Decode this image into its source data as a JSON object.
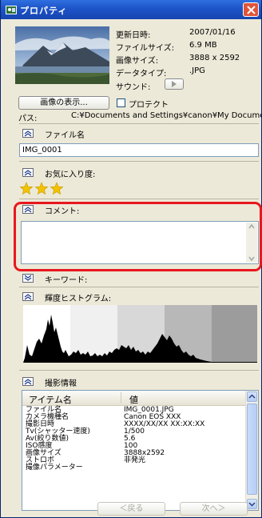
{
  "window": {
    "title": "プロパティ"
  },
  "info": [
    {
      "label": "更新日時:",
      "value": "2007/01/16"
    },
    {
      "label": "ファイルサイズ:",
      "value": "6.9 MB"
    },
    {
      "label": "画像サイズ:",
      "value": "3888 x 2592"
    },
    {
      "label": "データタイプ:",
      "value": ".JPG"
    },
    {
      "label": "サウンド:",
      "value": ""
    }
  ],
  "buttons": {
    "view_image": "画像の表示...",
    "protect": "プロテクト"
  },
  "path": {
    "label": "パス:",
    "value": "C:¥Documents and Settings¥canon¥My Documents"
  },
  "sections": {
    "filename": "ファイル名",
    "favorite": "お気に入り度:",
    "comment": "コメント:",
    "keyword": "キーワード:",
    "histogram": "輝度ヒストグラム:",
    "shooting": "撮影情報"
  },
  "filename_value": "IMG_0001",
  "favorite": {
    "stars": 3
  },
  "table": {
    "headers": [
      "アイテム名",
      "値"
    ],
    "rows": [
      [
        "ファイル名",
        "IMG_0001.JPG"
      ],
      [
        "カメラ機種名",
        "Canon EOS XXX"
      ],
      [
        "撮影日時",
        "XXXX/XX/XX XX:XX:XX"
      ],
      [
        "Tv(シャッター速度)",
        "1/500"
      ],
      [
        "Av(絞り数値)",
        "5.6"
      ],
      [
        "ISO感度",
        "100"
      ],
      [
        "画像サイズ",
        "3888x2592"
      ],
      [
        "ストロボ",
        "非発光"
      ],
      [
        "撮像パラメーター",
        ""
      ]
    ]
  },
  "nav": {
    "back": "＜戻る",
    "next": "次へ＞"
  },
  "colors": {
    "titlebar": "#1d54c8",
    "highlight": "#e8171f",
    "star": "#f2c200",
    "panel": "#ece9d8"
  }
}
